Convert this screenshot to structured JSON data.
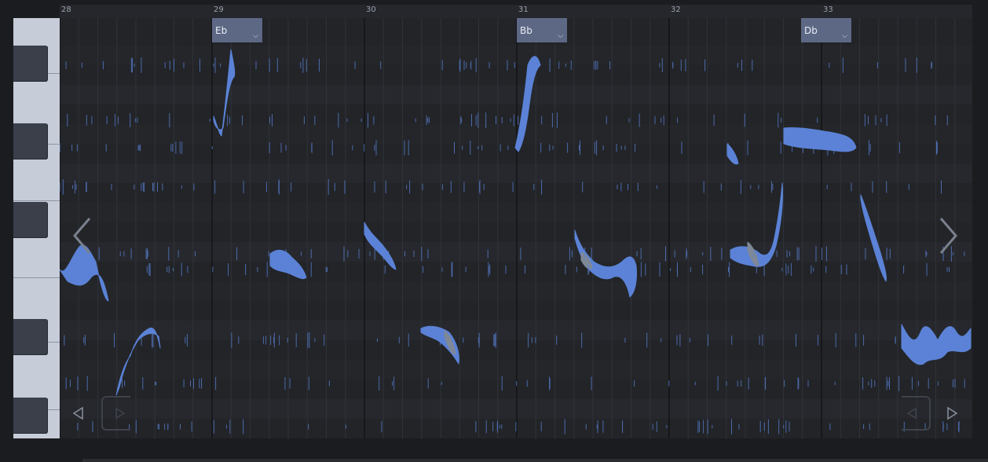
{
  "ruler": {
    "bars": [
      "28",
      "29",
      "30",
      "31",
      "32",
      "33"
    ]
  },
  "chords": [
    {
      "label": "Eb"
    },
    {
      "label": "Bb"
    },
    {
      "label": "Db"
    }
  ],
  "colors": {
    "pitch_blob": "#5b82d6",
    "pitch_blob_selected": "#7f8896",
    "chord_tag": "#5d6885"
  },
  "icons": {
    "prev_page": "chevron-left-icon",
    "next_page": "chevron-right-icon",
    "scroll_left": "triangle-left-icon",
    "scroll_right": "triangle-right-icon"
  }
}
